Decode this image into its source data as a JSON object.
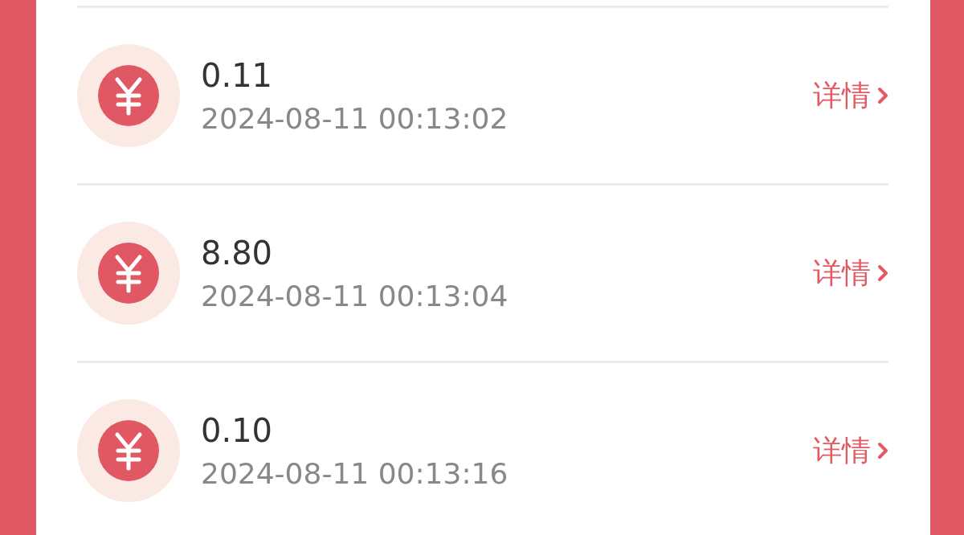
{
  "records": [
    {
      "amount": "0.11",
      "time": "2024-08-11 00:13:02",
      "action": "详情"
    },
    {
      "amount": "8.80",
      "time": "2024-08-11 00:13:04",
      "action": "详情"
    },
    {
      "amount": "0.10",
      "time": "2024-08-11 00:13:16",
      "action": "详情"
    }
  ]
}
